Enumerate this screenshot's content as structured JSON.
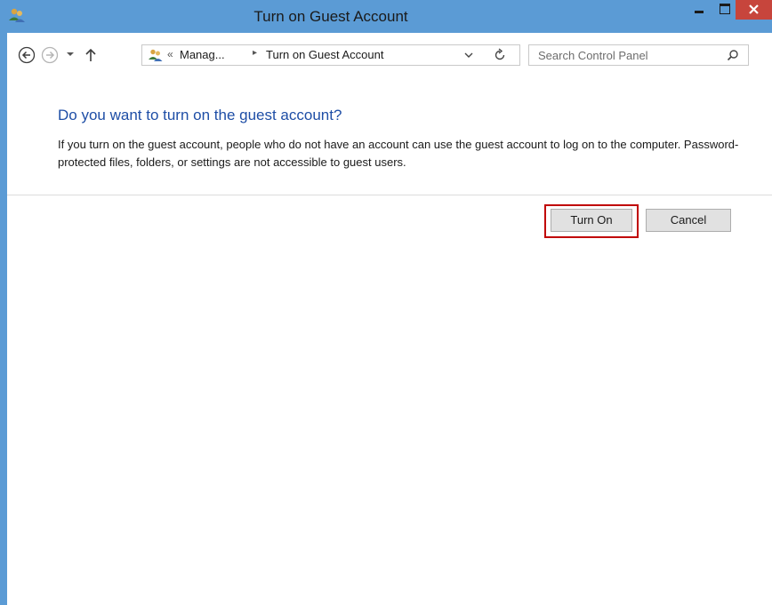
{
  "window": {
    "title": "Turn on Guest Account",
    "app_icon": "users-icon",
    "accent_color": "#5b9bd5",
    "close_color": "#c7453c"
  },
  "nav": {
    "back_icon": "back-arrow-icon",
    "forward_icon": "forward-arrow-icon",
    "recent_icon": "chevron-down-icon",
    "up_icon": "up-arrow-icon"
  },
  "address": {
    "overflow": "«",
    "segments": [
      "Manag...",
      "Turn on Guest Account"
    ],
    "separator": "▸",
    "refresh_icon": "refresh-icon"
  },
  "search": {
    "placeholder": "Search Control Panel",
    "icon": "search-icon"
  },
  "content": {
    "heading": "Do you want to turn on the guest account?",
    "description": "If you turn on the guest account, people who do not have an account can use the guest account to log on to the computer. Password-protected files, folders, or settings are not accessible to guest users.",
    "heading_color": "#1e4ea6"
  },
  "buttons": {
    "turn_on": "Turn On",
    "cancel": "Cancel",
    "highlight_color": "#c00000"
  }
}
